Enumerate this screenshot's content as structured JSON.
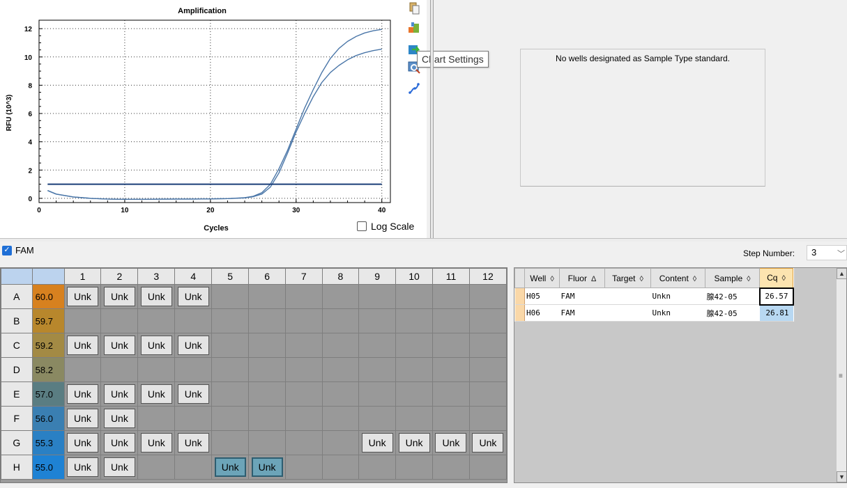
{
  "chart_data": {
    "type": "line",
    "title": "Amplification",
    "xlabel": "Cycles",
    "ylabel": "RFU (10^3)",
    "xlim": [
      0,
      41
    ],
    "ylim": [
      -0.3,
      12.6
    ],
    "xticks": [
      0,
      10,
      20,
      30,
      40
    ],
    "yticks": [
      0,
      2,
      4,
      6,
      8,
      10,
      12
    ],
    "grid": "dotted",
    "series": [
      {
        "x": [
          1,
          2,
          4,
          6,
          8,
          10,
          12,
          14,
          16,
          18,
          20,
          22,
          24,
          25,
          26,
          27,
          28,
          29,
          30,
          31,
          32,
          33,
          34,
          35,
          36,
          37,
          38,
          39,
          40
        ],
        "values": [
          0.55,
          0.3,
          0.1,
          0.0,
          -0.05,
          -0.07,
          -0.07,
          -0.06,
          -0.05,
          -0.05,
          -0.04,
          -0.02,
          0.05,
          0.15,
          0.4,
          1.0,
          2.1,
          3.4,
          4.9,
          6.4,
          7.7,
          8.9,
          9.9,
          10.6,
          11.1,
          11.45,
          11.7,
          11.85,
          11.95
        ],
        "color": "#4a76a8"
      },
      {
        "x": [
          1,
          2,
          4,
          6,
          8,
          10,
          12,
          14,
          16,
          18,
          20,
          22,
          24,
          25,
          26,
          27,
          28,
          29,
          30,
          31,
          32,
          33,
          34,
          35,
          36,
          37,
          38,
          39,
          40
        ],
        "values": [
          0.55,
          0.3,
          0.1,
          0.0,
          -0.05,
          -0.07,
          -0.07,
          -0.06,
          -0.05,
          -0.05,
          -0.04,
          -0.02,
          0.03,
          0.12,
          0.3,
          0.8,
          1.8,
          3.2,
          4.7,
          6.0,
          7.2,
          8.2,
          8.9,
          9.4,
          9.8,
          10.1,
          10.3,
          10.45,
          10.55
        ],
        "color": "#4a76a8"
      },
      {
        "x": [
          1,
          40
        ],
        "values": [
          1.0,
          1.0
        ],
        "color": "#1a3e78"
      }
    ]
  },
  "toolbar": {
    "icons": [
      "copy-icon",
      "export-icon",
      "export-chart-icon",
      "chart-settings-icon",
      "curve-icon"
    ],
    "tooltip": "Chart Settings"
  },
  "log_scale": {
    "label": "Log Scale",
    "checked": false
  },
  "standard_curve": {
    "message": "No wells designated as Sample Type standard."
  },
  "fluor_filter": {
    "label": "FAM",
    "checked": true
  },
  "step": {
    "label": "Step Number:",
    "value": "3"
  },
  "plate": {
    "columns": [
      "1",
      "2",
      "3",
      "4",
      "5",
      "6",
      "7",
      "8",
      "9",
      "10",
      "11",
      "12"
    ],
    "rows": [
      {
        "row": "A",
        "temp": "60.0",
        "temp_color": "#d7811f",
        "wells": [
          "Unk",
          "Unk",
          "Unk",
          "Unk",
          "",
          "",
          "",
          "",
          "",
          "",
          "",
          ""
        ],
        "selected": []
      },
      {
        "row": "B",
        "temp": "59.7",
        "temp_color": "#b8872c",
        "wells": [
          "",
          "",
          "",
          "",
          "",
          "",
          "",
          "",
          "",
          "",
          "",
          ""
        ],
        "selected": []
      },
      {
        "row": "C",
        "temp": "59.2",
        "temp_color": "#a38a44",
        "wells": [
          "Unk",
          "Unk",
          "Unk",
          "Unk",
          "",
          "",
          "",
          "",
          "",
          "",
          "",
          ""
        ],
        "selected": []
      },
      {
        "row": "D",
        "temp": "58.2",
        "temp_color": "#8a8962",
        "wells": [
          "",
          "",
          "",
          "",
          "",
          "",
          "",
          "",
          "",
          "",
          "",
          ""
        ],
        "selected": []
      },
      {
        "row": "E",
        "temp": "57.0",
        "temp_color": "#5a7d82",
        "wells": [
          "Unk",
          "Unk",
          "Unk",
          "Unk",
          "",
          "",
          "",
          "",
          "",
          "",
          "",
          ""
        ],
        "selected": []
      },
      {
        "row": "F",
        "temp": "56.0",
        "temp_color": "#3a7fb2",
        "wells": [
          "Unk",
          "Unk",
          "",
          "",
          "",
          "",
          "",
          "",
          "",
          "",
          "",
          ""
        ],
        "selected": []
      },
      {
        "row": "G",
        "temp": "55.3",
        "temp_color": "#2a80c4",
        "wells": [
          "Unk",
          "Unk",
          "Unk",
          "Unk",
          "",
          "",
          "",
          "",
          "Unk",
          "Unk",
          "Unk",
          "Unk"
        ],
        "selected": []
      },
      {
        "row": "H",
        "temp": "55.0",
        "temp_color": "#1e82d4",
        "wells": [
          "Unk",
          "Unk",
          "",
          "",
          "Unk",
          "Unk",
          "",
          "",
          "",
          "",
          "",
          ""
        ],
        "selected": [
          4,
          5
        ]
      }
    ]
  },
  "results": {
    "headers": [
      {
        "label": "Well",
        "sort": "◊"
      },
      {
        "label": "Fluor",
        "sort": "Δ"
      },
      {
        "label": "Target",
        "sort": "◊"
      },
      {
        "label": "Content",
        "sort": "◊"
      },
      {
        "label": "Sample",
        "sort": "◊"
      },
      {
        "label": "Cq",
        "sort": "◊"
      }
    ],
    "rows": [
      {
        "well": "H05",
        "fluor": "FAM",
        "target": "",
        "content": "Unkn",
        "sample": "腺42-05",
        "cq": "26.57"
      },
      {
        "well": "H06",
        "fluor": "FAM",
        "target": "",
        "content": "Unkn",
        "sample": "腺42-05",
        "cq": "26.81"
      }
    ]
  }
}
